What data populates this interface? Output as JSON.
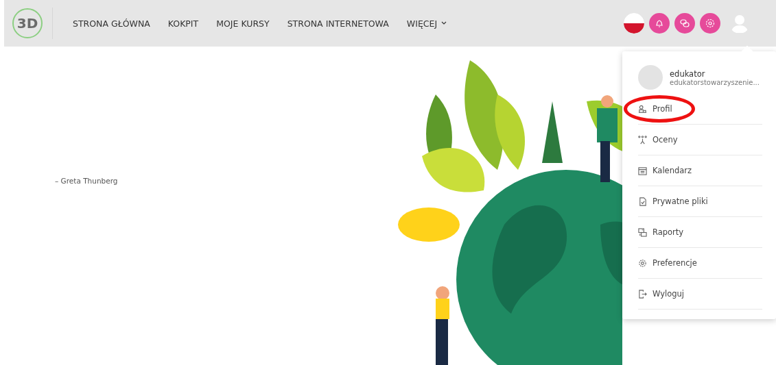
{
  "header": {
    "logo": "3D",
    "nav": [
      {
        "label": "STRONA GŁÓWNA",
        "dropdown": false
      },
      {
        "label": "KOKPIT",
        "dropdown": false
      },
      {
        "label": "MOJE KURSY",
        "dropdown": false
      },
      {
        "label": "STRONA INTERNETOWA",
        "dropdown": false
      },
      {
        "label": "WIĘCEJ",
        "dropdown": true
      }
    ],
    "actions": [
      {
        "kind": "flag"
      },
      {
        "kind": "bell"
      },
      {
        "kind": "chat"
      },
      {
        "kind": "gear"
      },
      {
        "kind": "user"
      }
    ]
  },
  "quote": {
    "author": "– Greta Thunberg"
  },
  "user_menu": {
    "username": "edukator",
    "email": "edukatorstowarzyszenie...",
    "items": [
      {
        "label": "Profil",
        "kind": "profile",
        "highlighted": true
      },
      {
        "label": "Oceny",
        "kind": "grades",
        "highlighted": false
      },
      {
        "label": "Kalendarz",
        "kind": "calendar",
        "highlighted": false
      },
      {
        "label": "Prywatne pliki",
        "kind": "files",
        "highlighted": false
      },
      {
        "label": "Raporty",
        "kind": "reports",
        "highlighted": false
      },
      {
        "label": "Preferencje",
        "kind": "preferences",
        "highlighted": false
      },
      {
        "label": "Wyloguj",
        "kind": "logout",
        "highlighted": false
      }
    ]
  }
}
